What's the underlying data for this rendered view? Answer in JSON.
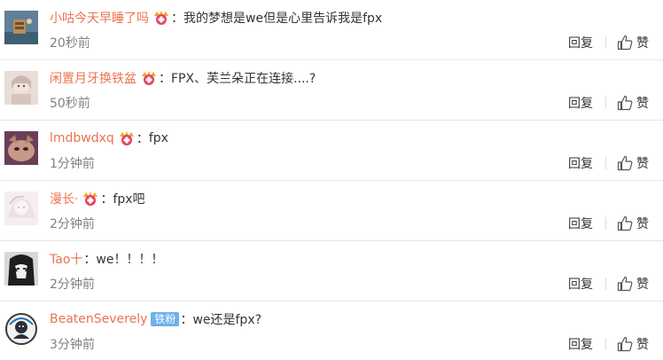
{
  "actions": {
    "reply_label": "回复",
    "like_label": "赞"
  },
  "comments": [
    {
      "username": "小咕今天早睡了吗",
      "badge": "vip-crown-icon",
      "colon": "：",
      "text": "我的梦想是we但是心里告诉我是fpx",
      "time": "20秒前"
    },
    {
      "username": "闲置月牙换铁盆",
      "badge": "vip-crown-icon",
      "colon": "：",
      "text": "FPX、芙兰朵正在连接....?",
      "time": "50秒前"
    },
    {
      "username": "lmdbwdxq",
      "badge": "vip-crown-icon",
      "colon": "：",
      "text": "fpx",
      "time": "1分钟前"
    },
    {
      "username": "漫长·",
      "badge": "vip-crown-icon",
      "colon": "：",
      "text": "fpx吧",
      "time": "2分钟前"
    },
    {
      "username": "Tao十",
      "badge": "",
      "colon": "：",
      "text": "we！！！！",
      "time": "2分钟前"
    },
    {
      "username": "BeatenSeverely",
      "badge_text": "铁粉",
      "colon": "：",
      "text": "we还是fpx?",
      "time": "3分钟前"
    }
  ],
  "colors": {
    "username": "#eb7350",
    "time": "#808080",
    "fan_badge": "#6eb0ee"
  }
}
